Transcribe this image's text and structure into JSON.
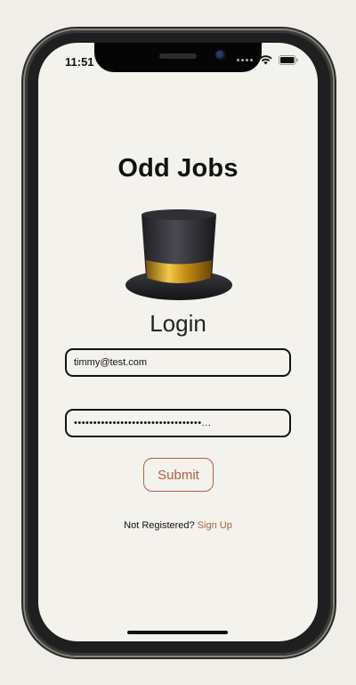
{
  "status_bar": {
    "time": "11:51",
    "icons": [
      "signal-icon",
      "wifi-icon",
      "battery-icon"
    ]
  },
  "app": {
    "title": "Odd Jobs",
    "logo_icon": "top-hat-icon"
  },
  "login": {
    "heading": "Login",
    "email_value": "timmy@test.com",
    "password_value": "•••••••••••••••••••••••••••••••••...",
    "submit_label": "Submit",
    "not_registered_text": "Not Registered?",
    "signup_link": "Sign Up"
  },
  "colors": {
    "accent": "#a8643f",
    "background": "#f4f2ec",
    "text": "#111111"
  }
}
